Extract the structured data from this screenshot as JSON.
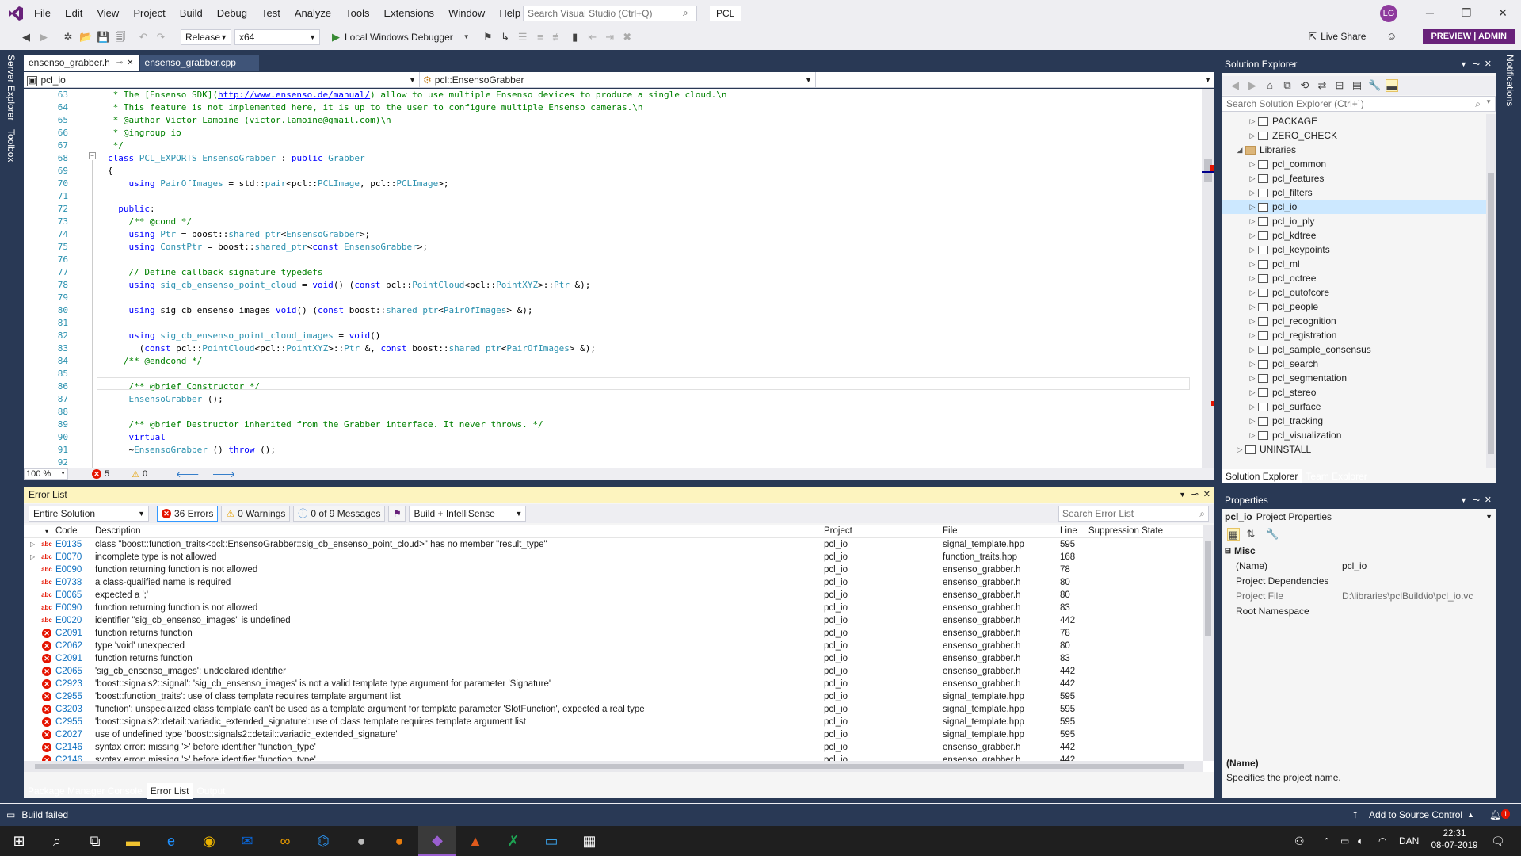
{
  "menu": [
    "File",
    "Edit",
    "View",
    "Project",
    "Build",
    "Debug",
    "Test",
    "Analyze",
    "Tools",
    "Extensions",
    "Window",
    "Help"
  ],
  "search_placeholder": "Search Visual Studio (Ctrl+Q)",
  "solution_name": "PCL",
  "user_initials": "LG",
  "toolbar": {
    "config": "Release",
    "platform": "x64",
    "debugger": "Local Windows Debugger",
    "live_share": "Live Share",
    "preview": "PREVIEW | ADMIN"
  },
  "left_strip": [
    "Server Explorer",
    "Toolbox"
  ],
  "right_strip": [
    "Notifications"
  ],
  "tabs": [
    {
      "label": "ensenso_grabber.h",
      "active": true
    },
    {
      "label": "ensenso_grabber.cpp",
      "active": false
    }
  ],
  "nav": {
    "project": "pcl_io",
    "scope": "pcl::EnsensoGrabber"
  },
  "code_lines": [
    {
      "n": "63",
      "t": " * The [Ensenso SDK](http://www.ensenso.de/manual/) allow to use multiple Ensenso devices to produce a single cloud.\\n"
    },
    {
      "n": "64",
      "t": " * This feature is not implemented here, it is up to the user to configure multiple Ensenso cameras.\\n"
    },
    {
      "n": "65",
      "t": " * @author Victor Lamoine (victor.lamoine@gmail.com)\\n"
    },
    {
      "n": "66",
      "t": " * @ingroup io"
    },
    {
      "n": "67",
      "t": " */"
    },
    {
      "n": "68",
      "t": "class PCL_EXPORTS EnsensoGrabber : public Grabber"
    },
    {
      "n": "69",
      "t": "{"
    },
    {
      "n": "70",
      "t": "    using PairOfImages = std::pair<pcl::PCLImage, pcl::PCLImage>;"
    },
    {
      "n": "71",
      "t": ""
    },
    {
      "n": "72",
      "t": "  public:"
    },
    {
      "n": "73",
      "t": "    /** @cond */"
    },
    {
      "n": "74",
      "t": "    using Ptr = boost::shared_ptr<EnsensoGrabber>;"
    },
    {
      "n": "75",
      "t": "    using ConstPtr = boost::shared_ptr<const EnsensoGrabber>;"
    },
    {
      "n": "76",
      "t": ""
    },
    {
      "n": "77",
      "t": "    // Define callback signature typedefs"
    },
    {
      "n": "78",
      "t": "    using sig_cb_ensenso_point_cloud = void() (const pcl::PointCloud<pcl::PointXYZ>::Ptr &);"
    },
    {
      "n": "79",
      "t": ""
    },
    {
      "n": "80",
      "t": "    using sig_cb_ensenso_images void() (const boost::shared_ptr<PairOfImages> &);"
    },
    {
      "n": "81",
      "t": ""
    },
    {
      "n": "82",
      "t": "    using sig_cb_ensenso_point_cloud_images = void()"
    },
    {
      "n": "83",
      "t": "      (const pcl::PointCloud<pcl::PointXYZ>::Ptr &, const boost::shared_ptr<PairOfImages> &);"
    },
    {
      "n": "84",
      "t": "   /** @endcond */"
    },
    {
      "n": "85",
      "t": ""
    },
    {
      "n": "86",
      "t": "    /** @brief Constructor */"
    },
    {
      "n": "87",
      "t": "    EnsensoGrabber ();"
    },
    {
      "n": "88",
      "t": ""
    },
    {
      "n": "89",
      "t": "    /** @brief Destructor inherited from the Grabber interface. It never throws. */"
    },
    {
      "n": "90",
      "t": "    virtual"
    },
    {
      "n": "91",
      "t": "    ~EnsensoGrabber () throw ();"
    },
    {
      "n": "92",
      "t": ""
    }
  ],
  "editor_status": {
    "zoom": "100 %",
    "errors": "5",
    "warnings": "0"
  },
  "error_list": {
    "title": "Error List",
    "scope": "Entire Solution",
    "errors_chip": "36 Errors",
    "warnings_chip": "0 Warnings",
    "messages_chip": "0 of 9 Messages",
    "build_filter": "Build + IntelliSense",
    "search_placeholder": "Search Error List",
    "headers": [
      "Code",
      "Description",
      "Project",
      "File",
      "Line",
      "Suppression State"
    ],
    "rows": [
      {
        "exp": "▷",
        "kind": "abc",
        "code": "E0135",
        "desc": "class \"boost::function_traits<pcl::EnsensoGrabber::sig_cb_ensenso_point_cloud>\" has no member \"result_type\"",
        "proj": "pcl_io",
        "file": "signal_template.hpp",
        "line": "595"
      },
      {
        "exp": "▷",
        "kind": "abc",
        "code": "E0070",
        "desc": "incomplete type is not allowed",
        "proj": "pcl_io",
        "file": "function_traits.hpp",
        "line": "168"
      },
      {
        "exp": "",
        "kind": "abc",
        "code": "E0090",
        "desc": "function returning function is not allowed",
        "proj": "pcl_io",
        "file": "ensenso_grabber.h",
        "line": "78"
      },
      {
        "exp": "",
        "kind": "abc",
        "code": "E0738",
        "desc": "a class-qualified name is required",
        "proj": "pcl_io",
        "file": "ensenso_grabber.h",
        "line": "80"
      },
      {
        "exp": "",
        "kind": "abc",
        "code": "E0065",
        "desc": "expected a ';'",
        "proj": "pcl_io",
        "file": "ensenso_grabber.h",
        "line": "80"
      },
      {
        "exp": "",
        "kind": "abc",
        "code": "E0090",
        "desc": "function returning function is not allowed",
        "proj": "pcl_io",
        "file": "ensenso_grabber.h",
        "line": "83"
      },
      {
        "exp": "",
        "kind": "abc",
        "code": "E0020",
        "desc": "identifier \"sig_cb_ensenso_images\" is undefined",
        "proj": "pcl_io",
        "file": "ensenso_grabber.h",
        "line": "442"
      },
      {
        "exp": "",
        "kind": "err",
        "code": "C2091",
        "desc": "function returns function",
        "proj": "pcl_io",
        "file": "ensenso_grabber.h",
        "line": "78"
      },
      {
        "exp": "",
        "kind": "err",
        "code": "C2062",
        "desc": "type 'void' unexpected",
        "proj": "pcl_io",
        "file": "ensenso_grabber.h",
        "line": "80"
      },
      {
        "exp": "",
        "kind": "err",
        "code": "C2091",
        "desc": "function returns function",
        "proj": "pcl_io",
        "file": "ensenso_grabber.h",
        "line": "83"
      },
      {
        "exp": "",
        "kind": "err",
        "code": "C2065",
        "desc": "'sig_cb_ensenso_images': undeclared identifier",
        "proj": "pcl_io",
        "file": "ensenso_grabber.h",
        "line": "442"
      },
      {
        "exp": "",
        "kind": "err",
        "code": "C2923",
        "desc": "'boost::signals2::signal': 'sig_cb_ensenso_images' is not a valid template type argument for parameter 'Signature'",
        "proj": "pcl_io",
        "file": "ensenso_grabber.h",
        "line": "442"
      },
      {
        "exp": "",
        "kind": "err",
        "code": "C2955",
        "desc": "'boost::function_traits': use of class template requires template argument list",
        "proj": "pcl_io",
        "file": "signal_template.hpp",
        "line": "595"
      },
      {
        "exp": "",
        "kind": "err",
        "code": "C3203",
        "desc": "'function': unspecialized class template can't be used as a template argument for template parameter 'SlotFunction', expected a real type",
        "proj": "pcl_io",
        "file": "signal_template.hpp",
        "line": "595"
      },
      {
        "exp": "",
        "kind": "err",
        "code": "C2955",
        "desc": "'boost::signals2::detail::variadic_extended_signature': use of class template requires template argument list",
        "proj": "pcl_io",
        "file": "signal_template.hpp",
        "line": "595"
      },
      {
        "exp": "",
        "kind": "err",
        "code": "C2027",
        "desc": "use of undefined type 'boost::signals2::detail::variadic_extended_signature'",
        "proj": "pcl_io",
        "file": "signal_template.hpp",
        "line": "595"
      },
      {
        "exp": "",
        "kind": "err",
        "code": "C2146",
        "desc": "syntax error: missing '>' before identifier 'function_type'",
        "proj": "pcl_io",
        "file": "ensenso_grabber.h",
        "line": "442"
      },
      {
        "exp": "",
        "kind": "err",
        "code": "C2146",
        "desc": "syntax error: missing '>' before identifier 'function_type'",
        "proj": "pcl_io",
        "file": "ensenso_grabber.h",
        "line": "442"
      }
    ]
  },
  "bottom_tabs": [
    "Package Manager Console",
    "Error List",
    "Output"
  ],
  "solution_explorer": {
    "title": "Solution Explorer",
    "search_placeholder": "Search Solution Explorer (Ctrl+`)",
    "items": [
      {
        "label": "PACKAGE",
        "depth": 1,
        "arrow": "▷",
        "type": "proj"
      },
      {
        "label": "ZERO_CHECK",
        "depth": 1,
        "arrow": "▷",
        "type": "proj"
      },
      {
        "label": "Libraries",
        "depth": 0,
        "arrow": "◢",
        "type": "folder"
      },
      {
        "label": "pcl_common",
        "depth": 1,
        "arrow": "▷",
        "type": "proj"
      },
      {
        "label": "pcl_features",
        "depth": 1,
        "arrow": "▷",
        "type": "proj"
      },
      {
        "label": "pcl_filters",
        "depth": 1,
        "arrow": "▷",
        "type": "proj"
      },
      {
        "label": "pcl_io",
        "depth": 1,
        "arrow": "▷",
        "type": "proj",
        "selected": true
      },
      {
        "label": "pcl_io_ply",
        "depth": 1,
        "arrow": "▷",
        "type": "proj"
      },
      {
        "label": "pcl_kdtree",
        "depth": 1,
        "arrow": "▷",
        "type": "proj"
      },
      {
        "label": "pcl_keypoints",
        "depth": 1,
        "arrow": "▷",
        "type": "proj"
      },
      {
        "label": "pcl_ml",
        "depth": 1,
        "arrow": "▷",
        "type": "proj"
      },
      {
        "label": "pcl_octree",
        "depth": 1,
        "arrow": "▷",
        "type": "proj"
      },
      {
        "label": "pcl_outofcore",
        "depth": 1,
        "arrow": "▷",
        "type": "proj"
      },
      {
        "label": "pcl_people",
        "depth": 1,
        "arrow": "▷",
        "type": "proj"
      },
      {
        "label": "pcl_recognition",
        "depth": 1,
        "arrow": "▷",
        "type": "proj"
      },
      {
        "label": "pcl_registration",
        "depth": 1,
        "arrow": "▷",
        "type": "proj"
      },
      {
        "label": "pcl_sample_consensus",
        "depth": 1,
        "arrow": "▷",
        "type": "proj"
      },
      {
        "label": "pcl_search",
        "depth": 1,
        "arrow": "▷",
        "type": "proj"
      },
      {
        "label": "pcl_segmentation",
        "depth": 1,
        "arrow": "▷",
        "type": "proj"
      },
      {
        "label": "pcl_stereo",
        "depth": 1,
        "arrow": "▷",
        "type": "proj"
      },
      {
        "label": "pcl_surface",
        "depth": 1,
        "arrow": "▷",
        "type": "proj"
      },
      {
        "label": "pcl_tracking",
        "depth": 1,
        "arrow": "▷",
        "type": "proj"
      },
      {
        "label": "pcl_visualization",
        "depth": 1,
        "arrow": "▷",
        "type": "proj"
      },
      {
        "label": "UNINSTALL",
        "depth": 0,
        "arrow": "▷",
        "type": "proj"
      }
    ],
    "tabs": [
      "Solution Explorer",
      "Team Explorer"
    ]
  },
  "properties": {
    "title": "Properties",
    "object": "pcl_io",
    "object_type": "Project Properties",
    "category": "Misc",
    "rows": [
      {
        "k": "(Name)",
        "v": "pcl_io",
        "dim": false
      },
      {
        "k": "Project Dependencies",
        "v": "",
        "dim": false
      },
      {
        "k": "Project File",
        "v": "D:\\libraries\\pclBuild\\io\\pcl_io.vc",
        "dim": true
      },
      {
        "k": "Root Namespace",
        "v": "",
        "dim": false
      }
    ],
    "desc_title": "(Name)",
    "desc_text": "Specifies the project name."
  },
  "status": {
    "text": "Build failed",
    "source_control": "Add to Source Control",
    "notif_count": "1"
  },
  "taskbar": {
    "lang": "DAN",
    "time": "22:31",
    "date": "08-07-2019"
  },
  "colors": {
    "accent": "#68217a",
    "frame": "#293955",
    "error": "#e51400",
    "warning_bar": "#fdf4bf",
    "selection": "#cce8ff"
  }
}
